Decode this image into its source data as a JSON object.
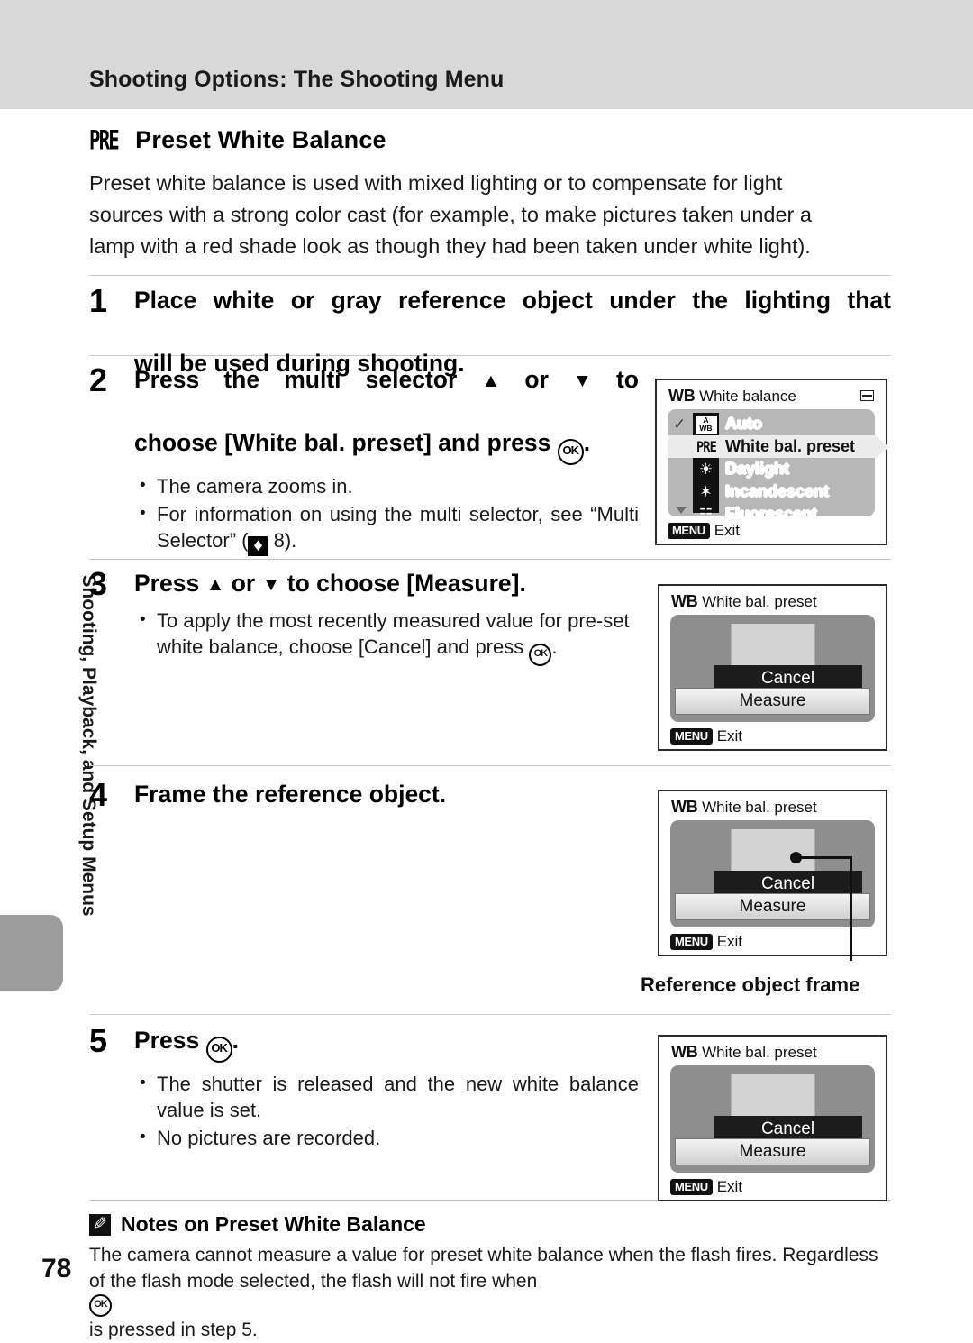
{
  "header": {
    "running_head": "Shooting Options: The Shooting Menu"
  },
  "side_tab": {
    "label": "Shooting, Playback, and Setup Menus"
  },
  "section": {
    "icon": "pre-icon",
    "icon_text": "PRE",
    "title": "Preset White Balance",
    "intro_lines": [
      "Preset white balance is used with mixed lighting or to compensate for light",
      "sources with a strong color cast (for example, to make pictures taken under a",
      "lamp with a red shade look as though they had been taken under white light)."
    ]
  },
  "steps": [
    {
      "number": "1",
      "title_lines": [
        "Place white or gray reference object under the lighting that",
        "will be used during shooting."
      ],
      "bullets": []
    },
    {
      "number": "2",
      "title_lines": [
        "Press the multi selector ▲ or ▼ to",
        "choose [White bal. preset] and press ⒪."
      ],
      "bullets": [
        "The camera zooms in.",
        "For information on using the multi selector, see “Multi Selector” (⬛ 8)."
      ]
    },
    {
      "number": "3",
      "title_lines": [
        "Press ▲ or ▼ to choose [Measure]."
      ],
      "bullets": [
        "To apply the most recently measured value for pre-set white balance, choose [Cancel] and press ⒪."
      ]
    },
    {
      "number": "4",
      "title_lines": [
        "Frame the reference object."
      ],
      "bullets": []
    },
    {
      "number": "5",
      "title_lines": [
        "Press ⒪."
      ],
      "bullets": [
        "The shutter is released and the new white balance value is set.",
        "No pictures are recorded."
      ]
    }
  ],
  "screens": {
    "white_balance_menu": {
      "title_prefix": "WB",
      "title": "White balance",
      "battery_icon": "battery-icon",
      "items": [
        {
          "icon": "awb-icon",
          "icon_top": "A",
          "icon_bottom": "WB",
          "label": "Auto",
          "checked": true,
          "selected": false
        },
        {
          "icon": "pre-icon",
          "icon_text": "PRE",
          "label": "White bal. preset",
          "checked": false,
          "selected": true
        },
        {
          "icon": "daylight-icon",
          "glyph": "☀",
          "label": "Daylight",
          "checked": false,
          "selected": false
        },
        {
          "icon": "incandescent-icon",
          "glyph": "✦",
          "label": "Incandescent",
          "checked": false,
          "selected": false
        },
        {
          "icon": "fluorescent-icon",
          "glyph": "☲",
          "label": "Fluorescent",
          "checked": false,
          "selected": false
        }
      ],
      "scroll_indicator": "scroll-down-icon",
      "menu_chip": "MENU",
      "exit_label": "Exit"
    },
    "preset_measure": {
      "title_prefix": "WB",
      "title": "White bal. preset",
      "cancel_label": "Cancel",
      "measure_label": "Measure",
      "menu_chip": "MENU",
      "exit_label": "Exit"
    }
  },
  "callout": {
    "label": "Reference object frame"
  },
  "note": {
    "icon": "pencil-note-icon",
    "title": "Notes on Preset White Balance",
    "body_lines": [
      "The camera cannot measure a value for preset white balance when the flash fires. Regardless",
      "of the flash mode selected, the flash will not fire when ⒪ is pressed in step 5."
    ]
  },
  "footer": {
    "page_number": "78"
  }
}
